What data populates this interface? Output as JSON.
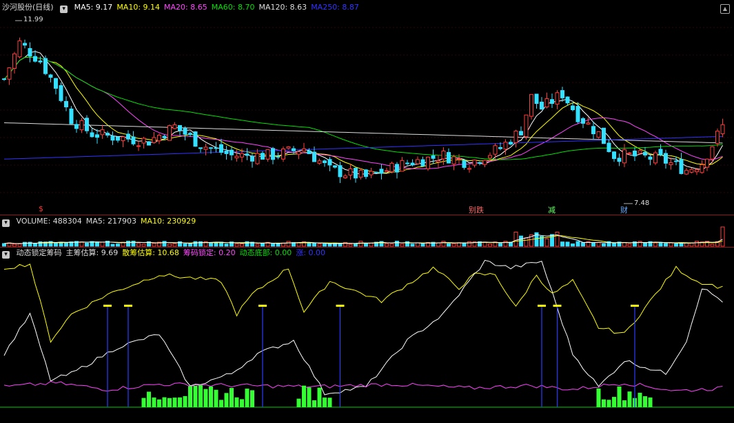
{
  "price_panel": {
    "title": "沙河股份(日线)",
    "ma": [
      {
        "label": "MA5: 9.17",
        "color": "#ffffff"
      },
      {
        "label": "MA10: 9.14",
        "color": "#ffff00"
      },
      {
        "label": "MA20: 8.65",
        "color": "#ff44ff"
      },
      {
        "label": "MA60: 8.70",
        "color": "#00e000"
      },
      {
        "label": "MA120: 8.63",
        "color": "#dddddd"
      },
      {
        "label": "MA250: 8.87",
        "color": "#3333ff"
      }
    ],
    "high_label": "11.99",
    "low_label": "7.48",
    "markers": [
      {
        "text": "$",
        "color": "#ff3333"
      },
      {
        "text": "别跌",
        "color": "#ff6666"
      },
      {
        "text": "减",
        "color": "#66ff66"
      },
      {
        "text": "财",
        "color": "#66aaff"
      }
    ]
  },
  "volume_panel": {
    "labels": [
      {
        "label": "VOLUME: 488304",
        "color": "#dddddd"
      },
      {
        "label": "MA5: 217903",
        "color": "#dddddd"
      },
      {
        "label": "MA10: 230929",
        "color": "#ffff00"
      }
    ]
  },
  "indicator_panel": {
    "labels": [
      {
        "label": "动态锁定筹码",
        "color": "#dddddd"
      },
      {
        "label": "主筹估算: 9.69",
        "color": "#dddddd"
      },
      {
        "label": "散筹估算: 10.68",
        "color": "#ffff00"
      },
      {
        "label": "筹码锁定: 0.20",
        "color": "#ff44ff"
      },
      {
        "label": "动态底部: 0.00",
        "color": "#00e000"
      },
      {
        "label": "涨: 0.00",
        "color": "#3333ff"
      }
    ]
  },
  "chart_data": [
    {
      "type": "candlestick",
      "title": "沙河股份(日线)",
      "ylim": [
        7.0,
        12.3
      ],
      "n": 140,
      "series": [
        {
          "name": "MA5",
          "color": "#ffffff"
        },
        {
          "name": "MA10",
          "color": "#ffff00"
        },
        {
          "name": "MA20",
          "color": "#ff44ff"
        },
        {
          "name": "MA60",
          "color": "#00e000"
        },
        {
          "name": "MA120",
          "color": "#dddddd"
        },
        {
          "name": "MA250",
          "color": "#3333ff"
        }
      ],
      "annotations": [
        {
          "text": "11.99",
          "value": 11.99
        },
        {
          "text": "7.48",
          "value": 7.48
        }
      ]
    },
    {
      "type": "bar",
      "title": "VOLUME",
      "series": [
        {
          "name": "VOLUME"
        },
        {
          "name": "MA5"
        },
        {
          "name": "MA10",
          "color": "#ffff00"
        }
      ]
    },
    {
      "type": "line",
      "title": "动态锁定筹码",
      "series": [
        {
          "name": "主筹估算",
          "color": "#ffffff"
        },
        {
          "name": "散筹估算",
          "color": "#ffff00"
        },
        {
          "name": "筹码锁定",
          "color": "#ff44ff"
        },
        {
          "name": "动态底部",
          "color": "#00ff00"
        },
        {
          "name": "涨",
          "color": "#3333ff"
        }
      ]
    }
  ]
}
